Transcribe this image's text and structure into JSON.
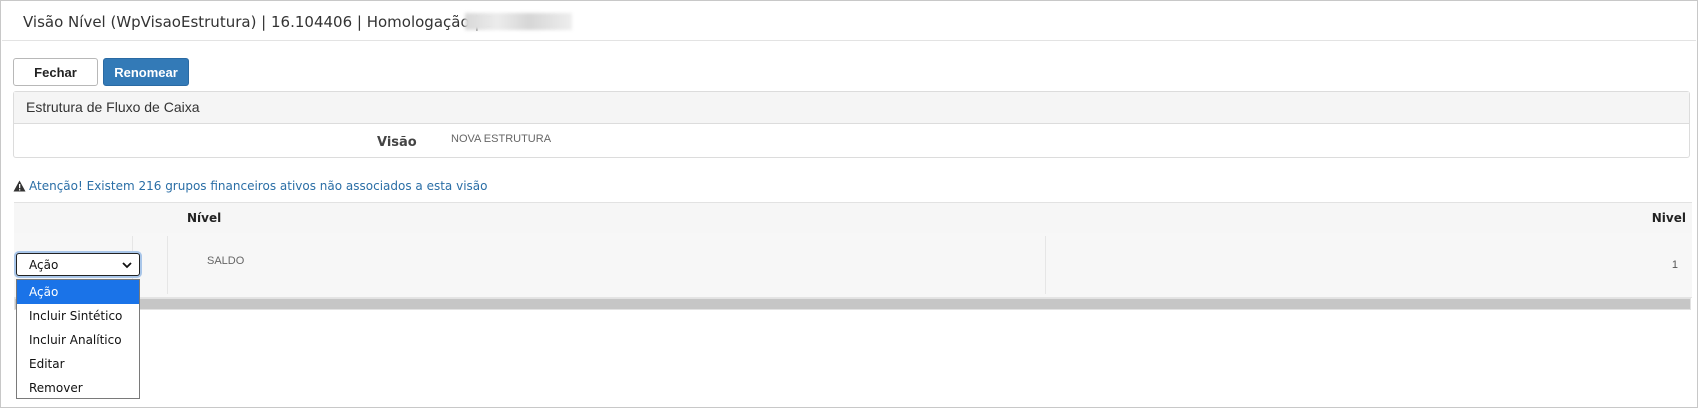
{
  "window": {
    "title": "Visão Nível (WpVisaoEstrutura) | 16.104406 | Homologação | S"
  },
  "toolbar": {
    "close_label": "Fechar",
    "rename_label": "Renomear"
  },
  "panel": {
    "heading": "Estrutura de Fluxo de Caixa",
    "field_label": "Visão",
    "field_value": "NOVA ESTRUTURA"
  },
  "warning": {
    "icon": "warning-icon",
    "text": "Atenção! Existem 216 grupos financeiros ativos não associados a esta visão"
  },
  "grid": {
    "columns": [
      "Nível",
      "Nivel"
    ],
    "rows": [
      {
        "name": "SALDO",
        "level": "1"
      }
    ]
  },
  "action_select": {
    "selected": "Ação",
    "options": [
      "Ação",
      "Incluir Sintético",
      "Incluir Analítico",
      "Editar",
      "Remover"
    ]
  },
  "colors": {
    "primary": "#337ab7",
    "link": "#2a6ea6",
    "option_highlight": "#1a73e8"
  }
}
